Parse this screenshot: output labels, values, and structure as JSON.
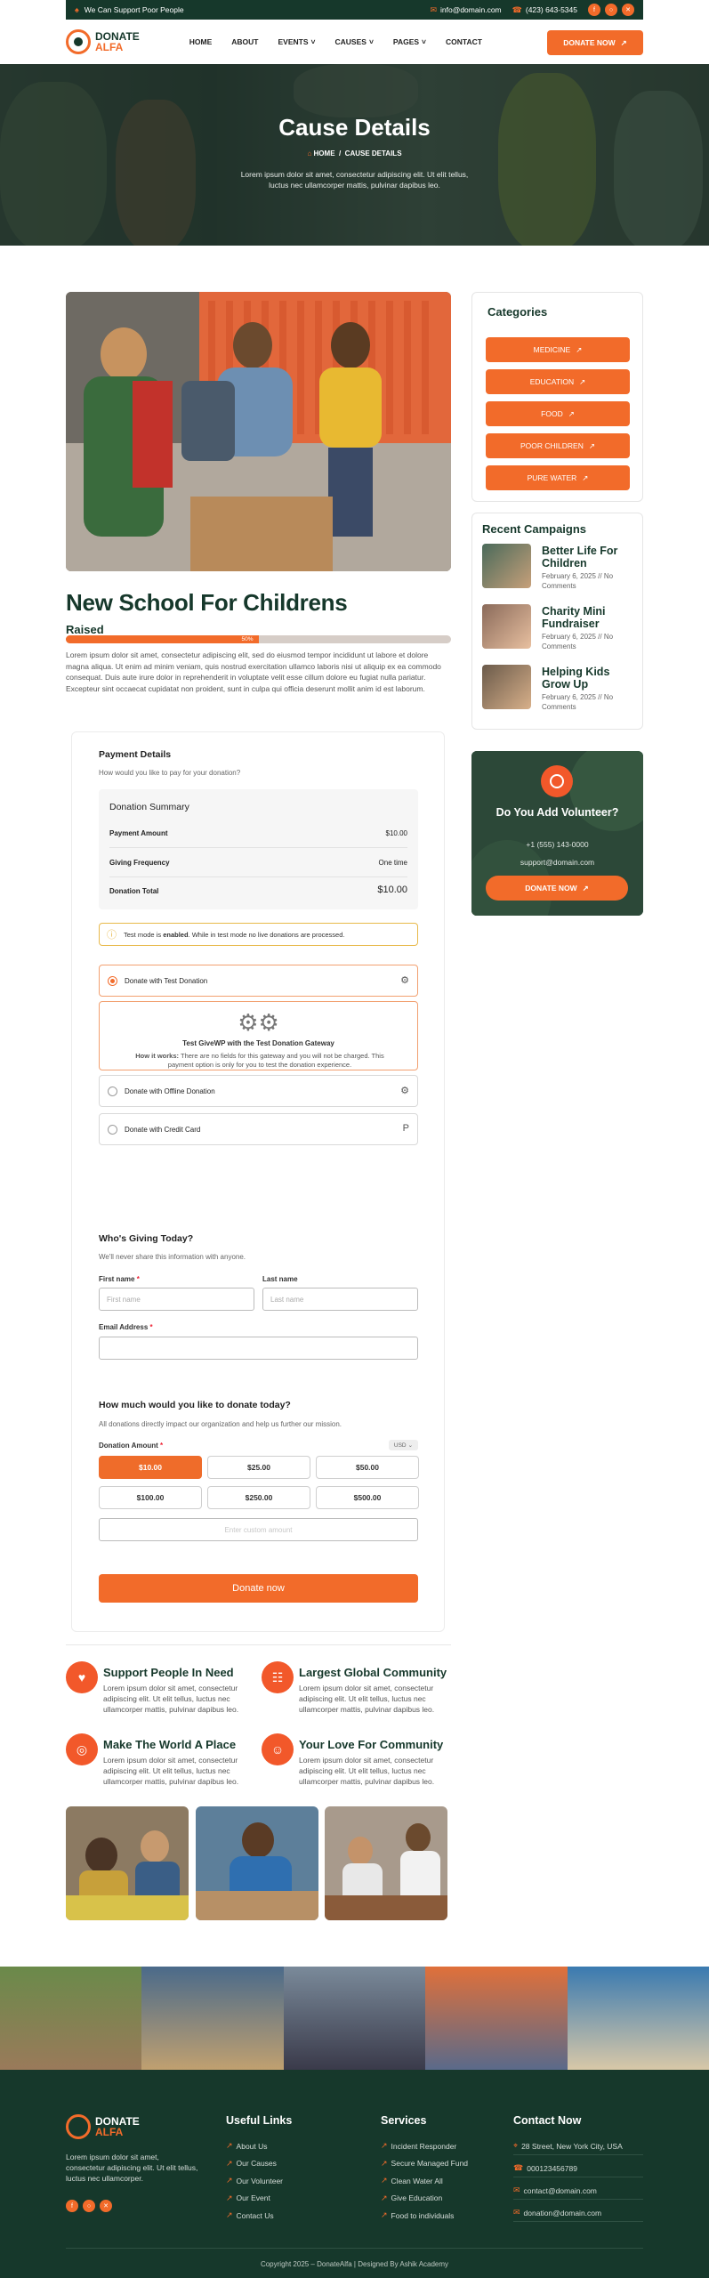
{
  "topbar": {
    "tagline": "We Can Support Poor People",
    "email": "info@domain.com",
    "phone": "(423) 643-5345"
  },
  "header": {
    "logo_top": "DONATE",
    "logo_bottom": "ALFA",
    "nav": [
      {
        "label": "HOME",
        "caret": false
      },
      {
        "label": "ABOUT",
        "caret": false
      },
      {
        "label": "EVENTS",
        "caret": true
      },
      {
        "label": "CAUSES",
        "caret": true
      },
      {
        "label": "PAGES",
        "caret": true
      },
      {
        "label": "CONTACT",
        "caret": false
      }
    ],
    "cta": "DONATE NOW"
  },
  "hero": {
    "title": "Cause Details",
    "crumb_home": "HOME",
    "crumb_sep": "/",
    "crumb_current": "CAUSE DETAILS",
    "desc": "Lorem ipsum dolor sit amet, consectetur adipiscing elit. Ut elit tellus, luctus nec ullamcorper mattis, pulvinar dapibus leo."
  },
  "cause": {
    "title": "New School For Childrens",
    "raised_label": "Raised",
    "progress_percent": 50,
    "progress_label": "50%",
    "paragraph": "Lorem ipsum dolor sit amet, consectetur adipiscing elit, sed do eiusmod tempor incididunt ut labore et dolore magna aliqua. Ut enim ad minim veniam, quis nostrud exercitation ullamco laboris nisi ut aliquip ex ea commodo consequat. Duis aute irure dolor in reprehenderit in voluptate velit esse cillum dolore eu fugiat nulla pariatur. Excepteur sint occaecat cupidatat non proident, sunt in culpa qui officia deserunt mollit anim id est laborum."
  },
  "sidebar": {
    "categories_title": "Categories",
    "categories": [
      "MEDICINE",
      "EDUCATION",
      "FOOD",
      "POOR CHILDREN",
      "PURE WATER"
    ],
    "recent_title": "Recent Campaigns",
    "recent": [
      {
        "title": "Better Life For Children",
        "meta": "February 6, 2025 // No Comments"
      },
      {
        "title": "Charity Mini Fundraiser",
        "meta": "February 6, 2025 // No Comments"
      },
      {
        "title": "Helping Kids Grow Up",
        "meta": "February 6, 2025 // No Comments"
      }
    ],
    "volunteer": {
      "title": "Do You Add Volunteer?",
      "phone": "+1 (555) 143-0000",
      "email": "support@domain.com",
      "cta": "DONATE NOW"
    }
  },
  "form": {
    "payment_title": "Payment Details",
    "payment_sub": "How would you like to pay for your donation?",
    "summary_title": "Donation Summary",
    "summary_rows": [
      {
        "label": "Payment Amount",
        "value": "$10.00"
      },
      {
        "label": "Giving Frequency",
        "value": "One time"
      }
    ],
    "total_label": "Donation Total",
    "total_value": "$10.00",
    "notice_pre": "Test mode is ",
    "notice_bold": "enabled",
    "notice_post": ". While in test mode no live donations are processed.",
    "gateways": [
      {
        "label": "Donate with Test Donation",
        "selected": true,
        "icon": "gear-icon"
      },
      {
        "label": "Donate with Offline Donation",
        "selected": false,
        "icon": "gear-icon"
      },
      {
        "label": "Donate with Credit Card",
        "selected": false,
        "icon": "paypal-icon"
      }
    ],
    "gateway_panel_title": "Test GiveWP with the Test Donation Gateway",
    "gateway_panel_how": "How it works:",
    "gateway_panel_text": "There are no fields for this gateway and you will not be charged. This payment option is only for you to test the donation experience.",
    "giving_title": "Who's Giving Today?",
    "giving_sub": "We'll never share this information with anyone.",
    "first_name_label": "First name",
    "first_name_placeholder": "First name",
    "last_name_label": "Last name",
    "last_name_placeholder": "Last name",
    "email_label": "Email Address",
    "required_mark": "*",
    "amount_title": "How much would you like to donate today?",
    "amount_sub": "All donations directly impact our organization and help us further our mission.",
    "amount_label": "Donation Amount",
    "currency": "USD",
    "amounts": [
      "$10.00",
      "$25.00",
      "$50.00",
      "$100.00",
      "$250.00",
      "$500.00"
    ],
    "selected_amount": "$10.00",
    "custom_placeholder": "Enter custom amount",
    "submit": "Donate now"
  },
  "features": [
    {
      "title": "Support People In Need",
      "desc": "Lorem ipsum dolor sit amet, consectetur adipiscing elit. Ut elit tellus, luctus nec ullamcorper mattis, pulvinar dapibus leo.",
      "icon": "hands-heart-icon"
    },
    {
      "title": "Largest Global Community",
      "desc": "Lorem ipsum dolor sit amet, consectetur adipiscing elit. Ut elit tellus, luctus nec ullamcorper mattis, pulvinar dapibus leo.",
      "icon": "community-icon"
    },
    {
      "title": "Make The World A Place",
      "desc": "Lorem ipsum dolor sit amet, consectetur adipiscing elit. Ut elit tellus, luctus nec ullamcorper mattis, pulvinar dapibus leo.",
      "icon": "globe-hand-icon"
    },
    {
      "title": "Your Love For Community",
      "desc": "Lorem ipsum dolor sit amet, consectetur adipiscing elit. Ut elit tellus, luctus nec ullamcorper mattis, pulvinar dapibus leo.",
      "icon": "people-icon"
    }
  ],
  "footer": {
    "logo_top": "DONATE",
    "logo_bottom": "ALFA",
    "about": "Lorem ipsum dolor sit amet, consectetur adipiscing elit. Ut elit tellus, luctus nec ullamcorper.",
    "useful_title": "Useful Links",
    "useful": [
      "About Us",
      "Our Causes",
      "Our Volunteer",
      "Our Event",
      "Contact Us"
    ],
    "services_title": "Services",
    "services": [
      "Incident Responder",
      "Secure Managed Fund",
      "Clean Water All",
      "Give Education",
      "Food to individuals"
    ],
    "contact_title": "Contact Now",
    "contact": [
      {
        "text": "28 Street, New York City, USA",
        "icon": "map-pin-icon"
      },
      {
        "text": "000123456789",
        "icon": "phone-icon"
      },
      {
        "text": "contact@domain.com",
        "icon": "mail-icon"
      },
      {
        "text": "donation@domain.com",
        "icon": "mail-icon"
      }
    ],
    "copyright": "Copyright 2025 – DonateAlfa | Designed By Ashik Academy"
  },
  "colors": {
    "accent": "#f26b2a",
    "dark": "#16382b"
  }
}
